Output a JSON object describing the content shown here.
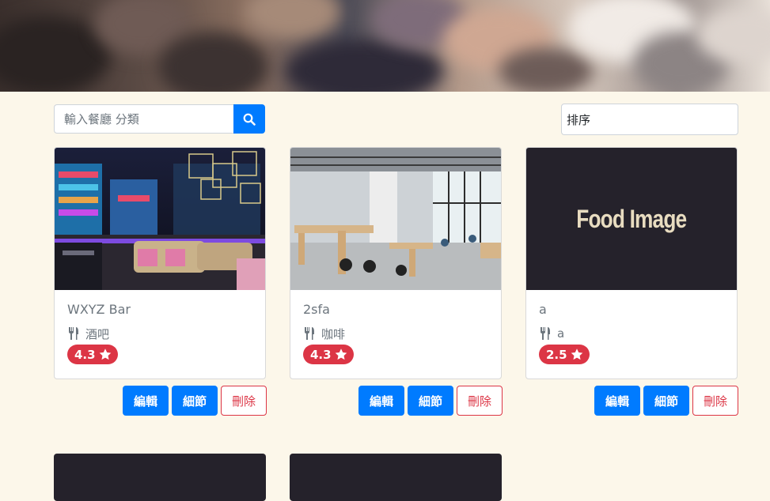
{
  "search": {
    "placeholder": "輸入餐廳 分類"
  },
  "sort": {
    "label": "排序"
  },
  "cards": [
    {
      "title": "WXYZ Bar",
      "category": "酒吧",
      "rating": "4.3",
      "image": "bar-photo"
    },
    {
      "title": "2sfa",
      "category": "咖啡",
      "rating": "4.3",
      "image": "cafe-photo"
    },
    {
      "title": "a",
      "category": "a",
      "rating": "2.5",
      "image": "Food Image"
    }
  ],
  "actions": {
    "edit_label": "編輯",
    "detail_label": "細節",
    "delete_label": "刪除"
  },
  "colors": {
    "primary": "#007bff",
    "danger": "#dc3545",
    "background": "#fcf7ea",
    "placeholder_dark": "#25222b"
  }
}
